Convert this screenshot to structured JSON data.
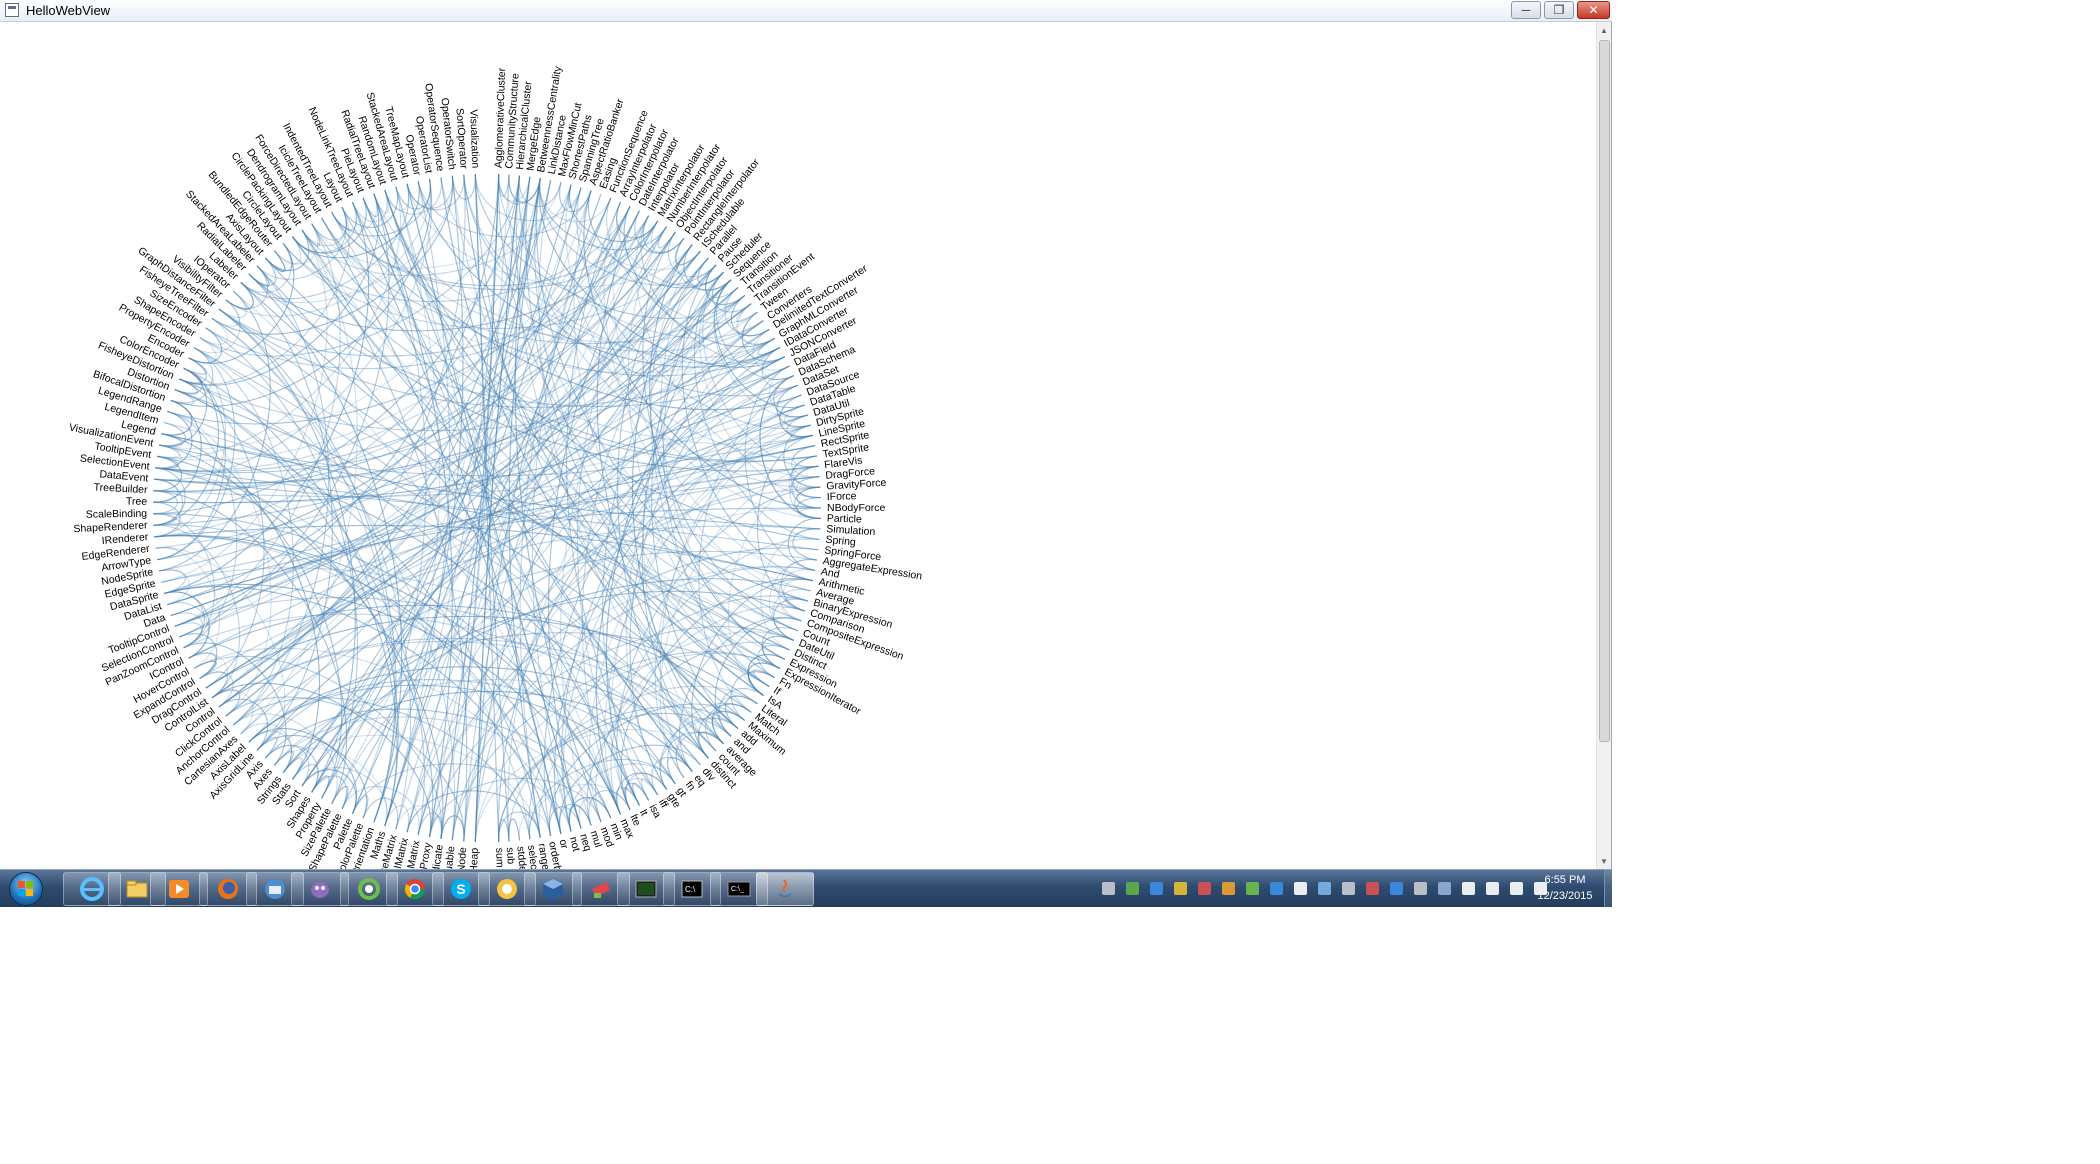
{
  "window": {
    "title": "HelloWebView",
    "minimize_glyph": "─",
    "maximize_glyph": "❐",
    "close_glyph": "✕"
  },
  "colors": {
    "edge": "#4682b4",
    "node_text": "#000000",
    "taskbar": "#2f4b6f"
  },
  "bundle": {
    "labels_right": [
      "AgglomerativeCluster",
      "CommunityStructure",
      "HierarchicalCluster",
      "MergeEdge",
      "BetweennessCentrality",
      "LinkDistance",
      "MaxFlowMinCut",
      "ShortestPaths",
      "SpanningTree",
      "AspectRatioBanker",
      "Easing",
      "FunctionSequence",
      "ArrayInterpolator",
      "ColorInterpolator",
      "DateInterpolator",
      "Interpolator",
      "MatrixInterpolator",
      "NumberInterpolator",
      "ObjectInterpolator",
      "PointInterpolator",
      "RectangleInterpolator",
      "ISchedulable",
      "Parallel",
      "Pause",
      "Scheduler",
      "Sequence",
      "Transition",
      "Transitioner",
      "TransitionEvent",
      "Tween",
      "Converters",
      "DelimitedTextConverter",
      "GraphMLConverter",
      "IDataConverter",
      "JSONConverter",
      "DataField",
      "DataSchema",
      "DataSet",
      "DataSource",
      "DataTable",
      "DataUtil",
      "DirtySprite",
      "LineSprite",
      "RectSprite",
      "TextSprite",
      "FlareVis",
      "DragForce",
      "GravityForce",
      "IForce",
      "NBodyForce",
      "Particle",
      "Simulation",
      "Spring",
      "SpringForce",
      "AggregateExpression",
      "And",
      "Arithmetic",
      "Average",
      "BinaryExpression",
      "Comparison",
      "CompositeExpression",
      "Count",
      "DateUtil",
      "Distinct",
      "Expression",
      "ExpressionIterator",
      "Fn",
      "If",
      "IsA",
      "Literal",
      "Match",
      "Maximum",
      "add",
      "and",
      "average",
      "count",
      "distinct",
      "div",
      "eq",
      "fn",
      "gt",
      "gte",
      "iff",
      "isa",
      "lt",
      "lte",
      "max",
      "min",
      "mod",
      "mul",
      "neq",
      "not",
      "or",
      "orderby",
      "range",
      "select",
      "stddev",
      "sub",
      "sum"
    ],
    "labels_left": [
      "Visualization",
      "SortOperator",
      "OperatorSwitch",
      "OperatorSequence",
      "OperatorList",
      "Operator",
      "TreeMapLayout",
      "StackedAreaLayout",
      "RandomLayout",
      "RadialTreeLayout",
      "PieLayout",
      "NodeLinkTreeLayout",
      "Layout",
      "IndentedTreeLayout",
      "IcicleTreeLayout",
      "ForceDirectedLayout",
      "DendrogramLayout",
      "CirclePackingLayout",
      "CircleLayout",
      "BundledEdgeRouter",
      "AxisLayout",
      "StackedAreaLabeler",
      "RadialLabeler",
      "Labeler",
      "IOperator",
      "VisibilityFilter",
      "GraphDistanceFilter",
      "FisheyeTreeFilter",
      "SizeEncoder",
      "ShapeEncoder",
      "PropertyEncoder",
      "Encoder",
      "ColorEncoder",
      "FisheyeDistortion",
      "Distortion",
      "BifocalDistortion",
      "LegendRange",
      "LegendItem",
      "Legend",
      "VisualizationEvent",
      "TooltipEvent",
      "SelectionEvent",
      "DataEvent",
      "TreeBuilder",
      "Tree",
      "ScaleBinding",
      "ShapeRenderer",
      "IRenderer",
      "EdgeRenderer",
      "ArrowType",
      "NodeSprite",
      "EdgeSprite",
      "DataSprite",
      "DataList",
      "Data",
      "TooltipControl",
      "SelectionControl",
      "PanZoomControl",
      "IControl",
      "HoverControl",
      "ExpandControl",
      "DragControl",
      "ControlList",
      "Control",
      "ClickControl",
      "AnchorControl",
      "CartesianAxes",
      "AxisLabel",
      "AxisGridLine",
      "Axis",
      "Axes",
      "Strings",
      "Stats",
      "Sort",
      "Shapes",
      "Property",
      "SizePalette",
      "ShapePalette",
      "Palette",
      "ColorPalette",
      "Orientation",
      "Maths",
      "SparseMatrix",
      "IMatrix",
      "DenseMatrix",
      "IValueProxy",
      "IPredicate",
      "IEvaluable",
      "Node",
      "Heap"
    ]
  },
  "taskbar": {
    "buttons": [
      {
        "name": "internet-explorer"
      },
      {
        "name": "file-explorer"
      },
      {
        "name": "media-player"
      },
      {
        "name": "firefox"
      },
      {
        "name": "thunderbird"
      },
      {
        "name": "pidgin"
      },
      {
        "name": "cycle-app"
      },
      {
        "name": "chrome"
      },
      {
        "name": "skype"
      },
      {
        "name": "sticky-app"
      },
      {
        "name": "virtualbox"
      },
      {
        "name": "eraser-app"
      },
      {
        "name": "terminal-app"
      },
      {
        "name": "cmd-prompt"
      },
      {
        "name": "console"
      },
      {
        "name": "java"
      }
    ],
    "clock": {
      "time": "6:55 PM",
      "date": "12/23/2015"
    }
  }
}
